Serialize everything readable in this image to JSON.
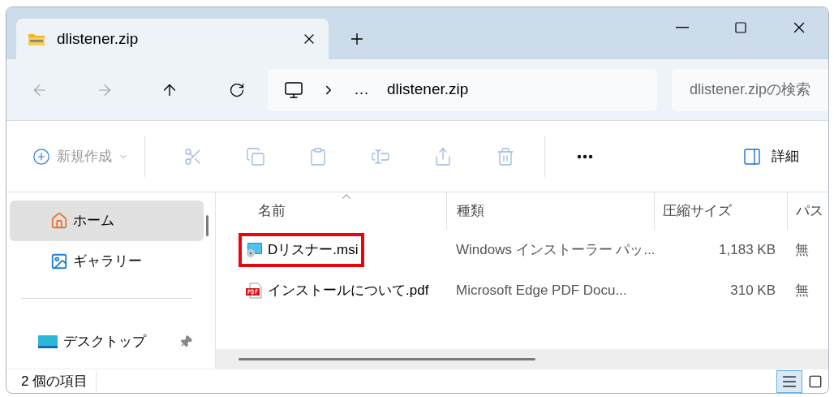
{
  "window": {
    "tabs": [
      {
        "title": "dlistener.zip",
        "selected": true
      }
    ]
  },
  "address_bar": {
    "path": [
      "…",
      "dlistener.zip"
    ]
  },
  "search": {
    "placeholder": "dlistener.zipの検索"
  },
  "toolbar": {
    "new": {
      "label": "新規作成",
      "disabled": true
    },
    "actions": [
      {
        "kind": "cut",
        "disabled": true
      },
      {
        "kind": "copy",
        "disabled": true
      },
      {
        "kind": "paste",
        "disabled": true
      },
      {
        "kind": "rename",
        "disabled": true
      },
      {
        "kind": "share",
        "disabled": true
      },
      {
        "kind": "delete",
        "disabled": true
      },
      {
        "kind": "more",
        "disabled": false
      }
    ],
    "details": {
      "label": "詳細"
    }
  },
  "sidebar": {
    "groups": [
      [
        {
          "kind": "home",
          "label": "ホーム",
          "selected": true,
          "pinned": false
        },
        {
          "kind": "gallery",
          "label": "ギャラリー",
          "selected": false,
          "pinned": false
        }
      ],
      [
        {
          "kind": "desktop",
          "label": "デスクトップ",
          "selected": false,
          "pinned": true
        }
      ]
    ]
  },
  "table": {
    "columns": [
      "名前",
      "種類",
      "圧縮サイズ",
      "パス"
    ],
    "rows": [
      {
        "kind": "msi",
        "name": "Dリスナー.msi",
        "type": "Windows インストーラー パッ...",
        "size": "1,183 KB",
        "password": "無",
        "highlighted": true
      },
      {
        "kind": "pdf",
        "name": "インストールについて.pdf",
        "type": "Microsoft Edge PDF Docu...",
        "size": "310 KB",
        "password": "無",
        "highlighted": false
      }
    ]
  },
  "status_bar": {
    "count": "2 個の項目",
    "views": [
      {
        "kind": "details",
        "selected": true
      },
      {
        "kind": "tiles",
        "selected": false
      }
    ]
  }
}
